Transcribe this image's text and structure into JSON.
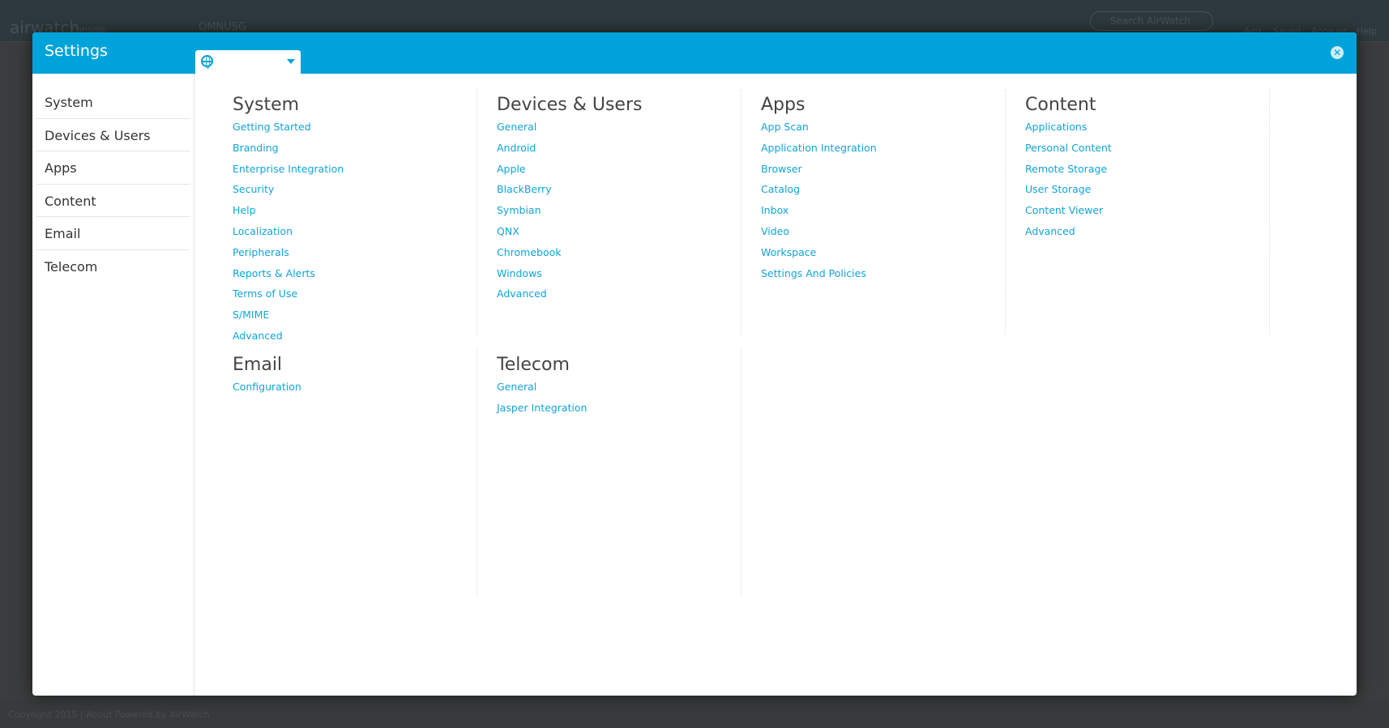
{
  "background": {
    "logo": "airwatch",
    "logo_sub": "console",
    "org_selector": "OMNUSG",
    "search_placeholder": "Search AirWatch",
    "nav": [
      "Add",
      "Saved",
      "Account",
      "Help"
    ],
    "footer": "Copyright 2015 | About    Powered by AirWatch"
  },
  "modal": {
    "title": "Settings",
    "org_dropdown": "",
    "colors": {
      "header": "#00a3d9",
      "link": "#12a3d8"
    }
  },
  "sidebar": {
    "items": [
      {
        "label": "System"
      },
      {
        "label": "Devices & Users"
      },
      {
        "label": "Apps"
      },
      {
        "label": "Content"
      },
      {
        "label": "Email"
      },
      {
        "label": "Telecom"
      }
    ]
  },
  "sections": [
    {
      "title": "System",
      "links": [
        "Getting Started",
        "Branding",
        "Enterprise Integration",
        "Security",
        "Help",
        "Localization",
        "Peripherals",
        "Reports & Alerts",
        "Terms of Use",
        "S/MIME",
        "Advanced"
      ]
    },
    {
      "title": "Devices & Users",
      "links": [
        "General",
        "Android",
        "Apple",
        "BlackBerry",
        "Symbian",
        "QNX",
        "Chromebook",
        "Windows",
        "Advanced"
      ]
    },
    {
      "title": "Apps",
      "links": [
        "App Scan",
        "Application Integration",
        "Browser",
        "Catalog",
        "Inbox",
        "Video",
        "Workspace",
        "Settings And Policies"
      ]
    },
    {
      "title": "Content",
      "links": [
        "Applications",
        "Personal Content",
        "Remote Storage",
        "User Storage",
        "Content Viewer",
        "Advanced"
      ]
    },
    {
      "title": "Email",
      "links": [
        "Configuration"
      ]
    },
    {
      "title": "Telecom",
      "links": [
        "General",
        "Jasper Integration"
      ]
    }
  ]
}
